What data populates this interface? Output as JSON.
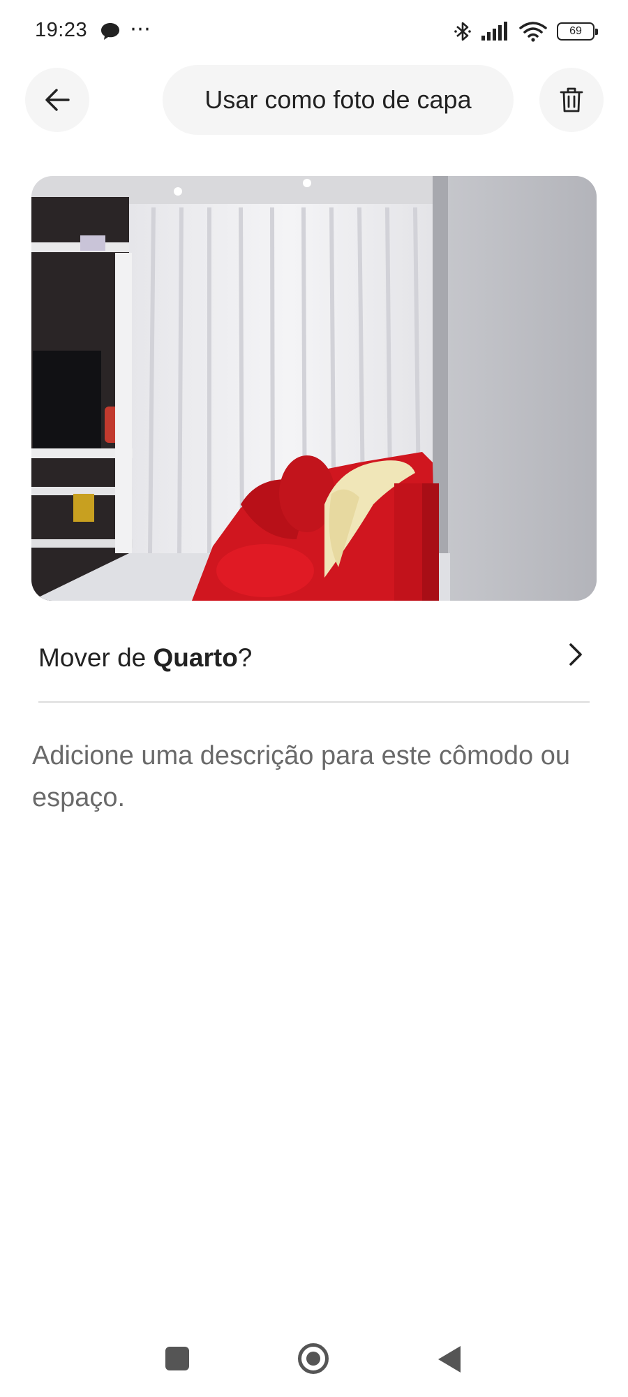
{
  "status_bar": {
    "time": "19:23",
    "dots": "⋯",
    "battery": "69",
    "icons": [
      "chat-bubble-icon",
      "bluetooth-icon",
      "signal-icon",
      "wifi-icon",
      "battery-icon"
    ]
  },
  "header": {
    "back_icon": "arrow-left-icon",
    "cover_label": "Usar como foto de capa",
    "delete_icon": "trash-icon"
  },
  "photo": {
    "subject": "living room with red sofa, white curtains and TV shelf"
  },
  "move_room": {
    "prefix": "Mover de ",
    "room": "Quarto",
    "suffix": "?",
    "chevron_icon": "chevron-right-icon"
  },
  "description": {
    "placeholder": "Adicione uma descrição para este cômodo ou espaço."
  },
  "nav_bar": {
    "icons": [
      "recents-icon",
      "home-icon",
      "back-triangle-icon"
    ]
  },
  "colors": {
    "button_bg": "#f5f5f5",
    "text": "#222222",
    "muted_text": "#6a6a6a",
    "divider": "#dddddd",
    "sofa_red": "#d0161f"
  }
}
